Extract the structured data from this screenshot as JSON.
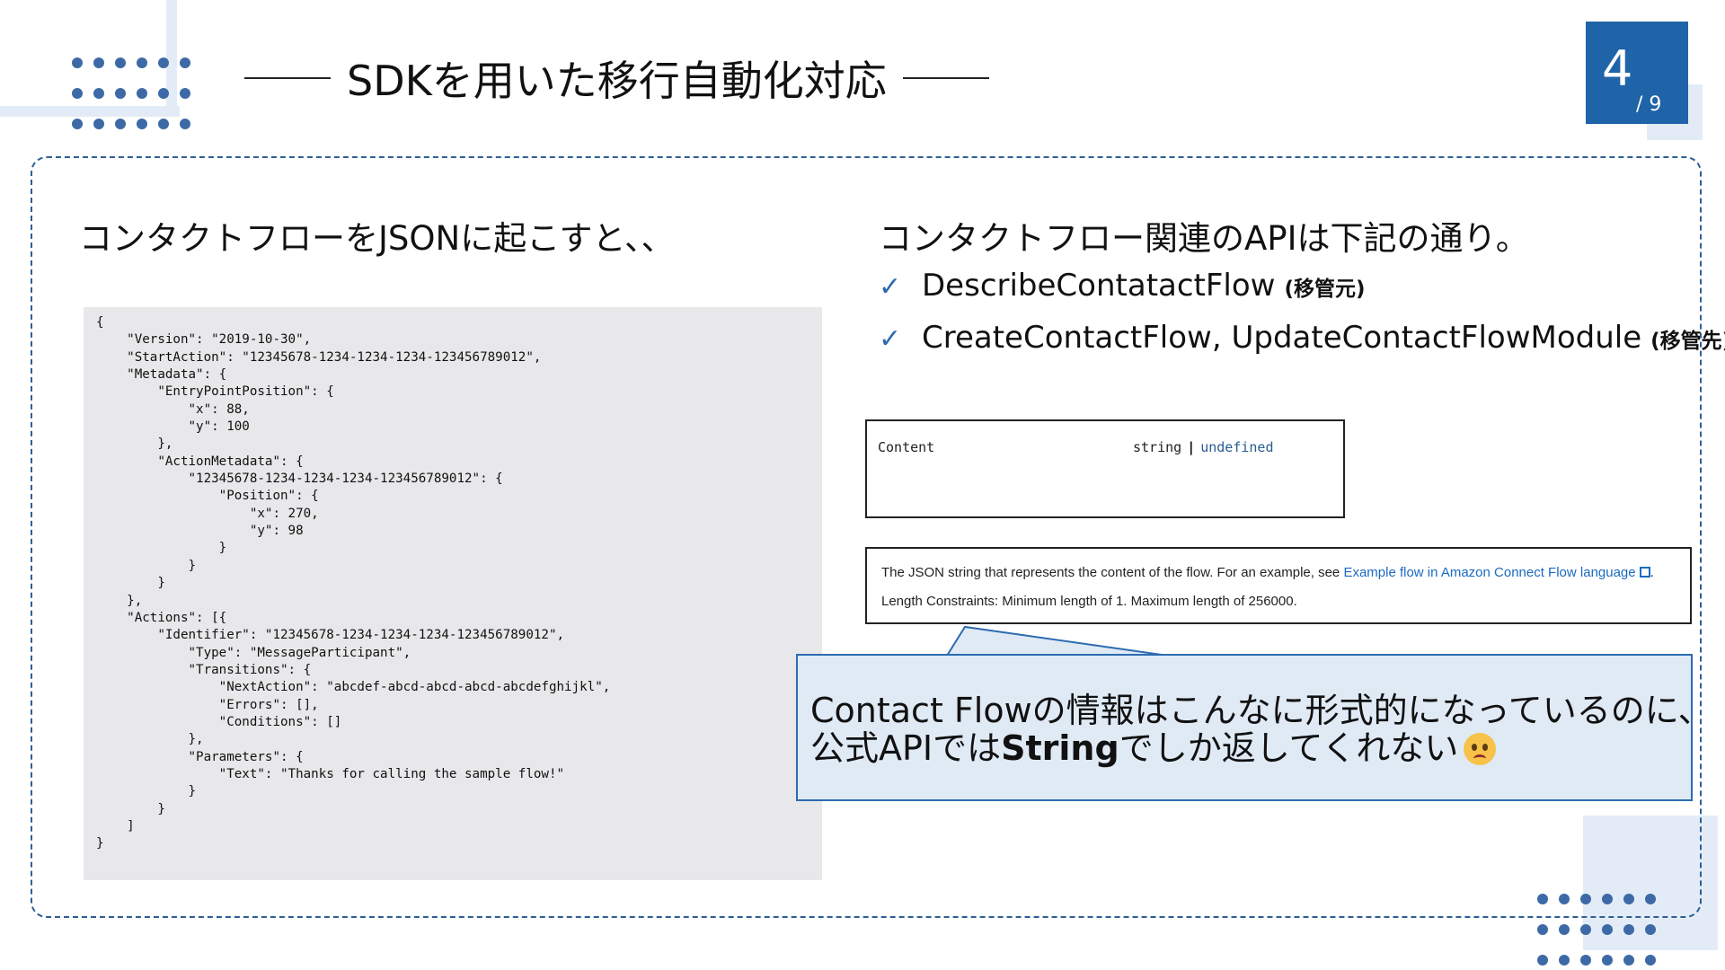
{
  "header": {
    "title": "SDKを用いた移行自動化対応",
    "page_current": "4",
    "page_total": "/ 9"
  },
  "left": {
    "heading": "コンタクトフローをJSONに起こすと、、",
    "code": "{\n    \"Version\": \"2019-10-30\",\n    \"StartAction\": \"12345678-1234-1234-1234-123456789012\",\n    \"Metadata\": {\n        \"EntryPointPosition\": {\n            \"x\": 88,\n            \"y\": 100\n        },\n        \"ActionMetadata\": {\n            \"12345678-1234-1234-1234-123456789012\": {\n                \"Position\": {\n                    \"x\": 270,\n                    \"y\": 98\n                }\n            }\n        }\n    },\n    \"Actions\": [{\n        \"Identifier\": \"12345678-1234-1234-1234-123456789012\",\n            \"Type\": \"MessageParticipant\",\n            \"Transitions\": {\n                \"NextAction\": \"abcdef-abcd-abcd-abcd-abcdefghijkl\",\n                \"Errors\": [],\n                \"Conditions\": []\n            },\n            \"Parameters\": {\n                \"Text\": \"Thanks for calling the sample flow!\"\n            }\n        }\n    ]\n}"
  },
  "right": {
    "heading": "コンタクトフロー関連のAPIは下記の通り。",
    "apis": [
      {
        "check": "✓",
        "name": "DescribeContatactFlow",
        "note_open": "(",
        "note": "移管元",
        "note_close": ")"
      },
      {
        "check": "✓",
        "name": "CreateContactFlow, UpdateContactFlowModule",
        "note_open": "(",
        "note": "移管先",
        "note_close": ")"
      }
    ],
    "content_field": {
      "label": "Content",
      "type": "string",
      "separator": "|",
      "type_alt": "undefined"
    },
    "description": {
      "line1_prefix": "The JSON string that represents the content of the flow. For an example, see ",
      "line1_link": "Example flow in Amazon Connect Flow language",
      "line1_suffix": ".",
      "line2": "Length Constraints: Minimum length of 1. Maximum length of 256000."
    },
    "callout": {
      "line1": "Contact Flowの情報はこんなに形式的になっているのに、",
      "line2_prefix": "公式APIでは",
      "line2_bold": "String",
      "line2_suffix": "でしか返してくれない"
    }
  },
  "colors": {
    "accent": "#1f63a8",
    "light_accent": "#e3ecf6",
    "callout_bg": "#e0eaf5",
    "code_bg": "#e8e8ea"
  }
}
